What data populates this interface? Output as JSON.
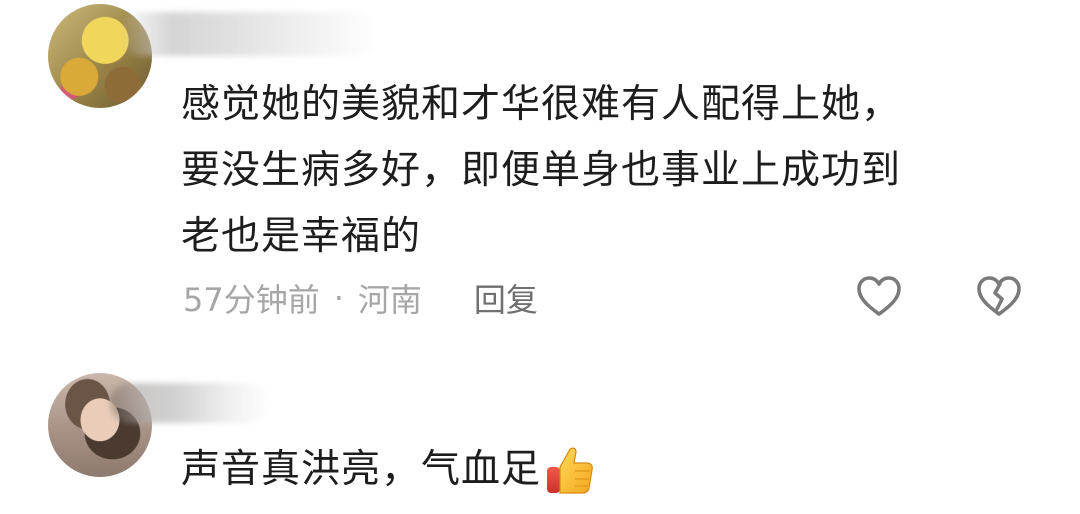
{
  "comments": [
    {
      "text_lines": [
        "感觉她的美貌和才华很难有人配得上她，",
        "要没生病多好，即便单身也事业上成功到",
        "老也是幸福的"
      ],
      "time": "57分钟前",
      "separator": "·",
      "location": "河南",
      "reply_label": "回复",
      "like_icon": "heart-outline-icon",
      "dislike_icon": "broken-heart-icon"
    },
    {
      "text": "声音真洪亮，气血足",
      "emoji": "thumbs-up-icon"
    }
  ],
  "colors": {
    "text": "#1d1d1d",
    "meta": "#a6a6a6",
    "reply": "#6f6f6f",
    "icon": "#7a7a7a"
  }
}
